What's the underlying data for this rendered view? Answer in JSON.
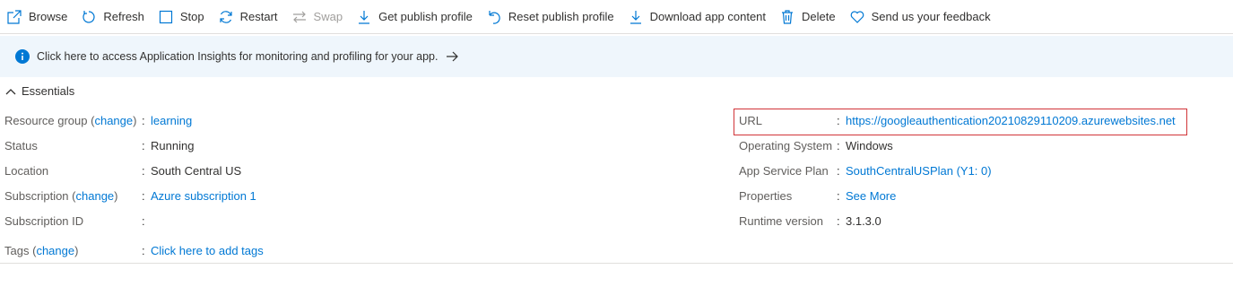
{
  "toolbar": {
    "browse": "Browse",
    "refresh": "Refresh",
    "stop": "Stop",
    "restart": "Restart",
    "swap": "Swap",
    "get_publish_profile": "Get publish profile",
    "reset_publish_profile": "Reset publish profile",
    "download_app_content": "Download app content",
    "delete": "Delete",
    "feedback": "Send us your feedback"
  },
  "banner": {
    "text": "Click here to access Application Insights for monitoring and profiling for your app."
  },
  "essentials": {
    "title": "Essentials",
    "separator": ":",
    "change": "change",
    "left": {
      "resource_group_label": "Resource group",
      "resource_group_value": "learning",
      "status_label": "Status",
      "status_value": "Running",
      "location_label": "Location",
      "location_value": "South Central US",
      "subscription_label": "Subscription",
      "subscription_value": "Azure subscription 1",
      "subscription_id_label": "Subscription ID",
      "subscription_id_value": "",
      "tags_label": "Tags",
      "tags_value": "Click here to add tags"
    },
    "right": {
      "url_label": "URL",
      "url_value": "https://googleauthentication20210829110209.azurewebsites.net",
      "os_label": "Operating System",
      "os_value": "Windows",
      "plan_label": "App Service Plan",
      "plan_value": "SouthCentralUSPlan (Y1: 0)",
      "properties_label": "Properties",
      "properties_value": "See More",
      "runtime_label": "Runtime version",
      "runtime_value": "3.1.3.0"
    }
  },
  "colors": {
    "link": "#0078d4",
    "banner_bg": "#eff6fc",
    "highlight_border": "#d13438"
  }
}
